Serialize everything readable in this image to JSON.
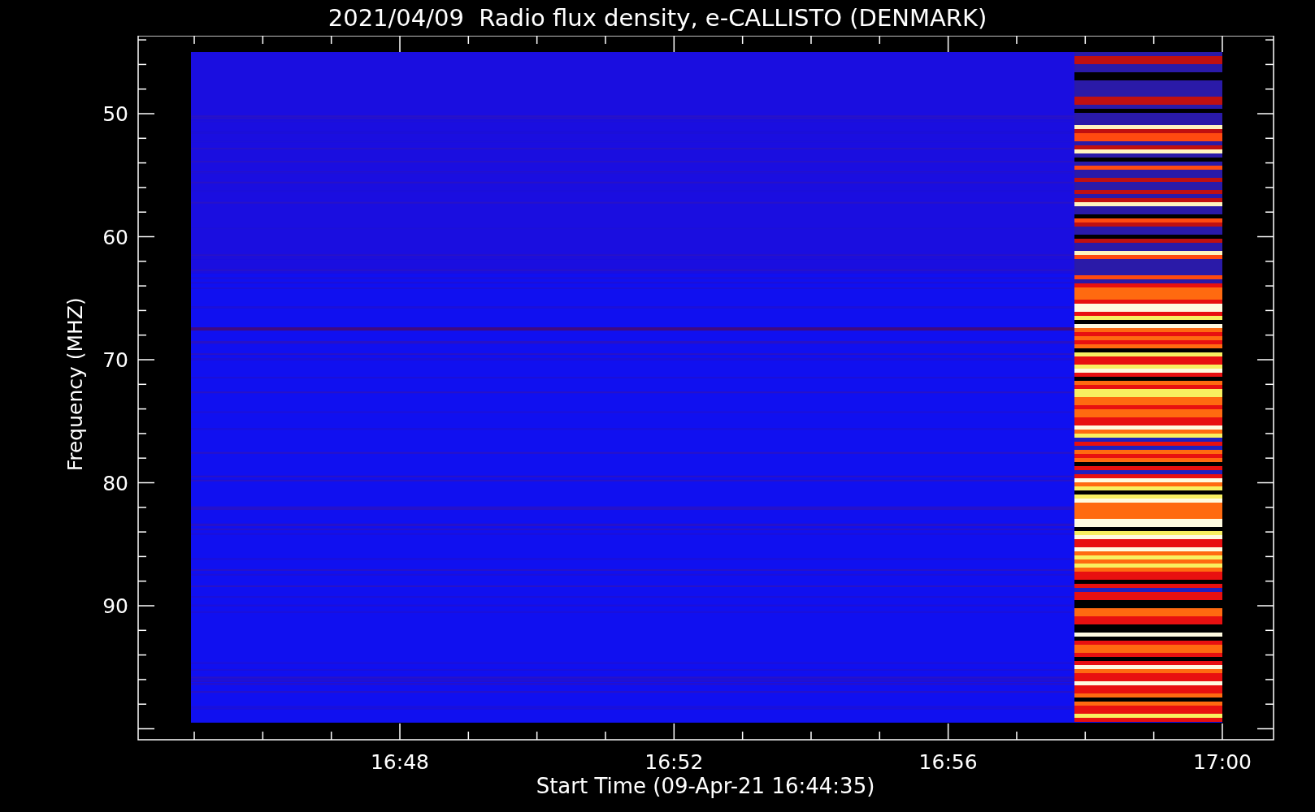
{
  "title": "2021/04/09  Radio flux density, e-CALLISTO (DENMARK)",
  "plot": {
    "xlabel": "Start Time (09-Apr-21 16:44:35)",
    "ylabel": "Frequency (MHZ)",
    "xticks": [
      "16:48",
      "16:52",
      "16:56",
      "17:00"
    ],
    "yticks": [
      "50",
      "60",
      "70",
      "80",
      "90"
    ]
  }
}
